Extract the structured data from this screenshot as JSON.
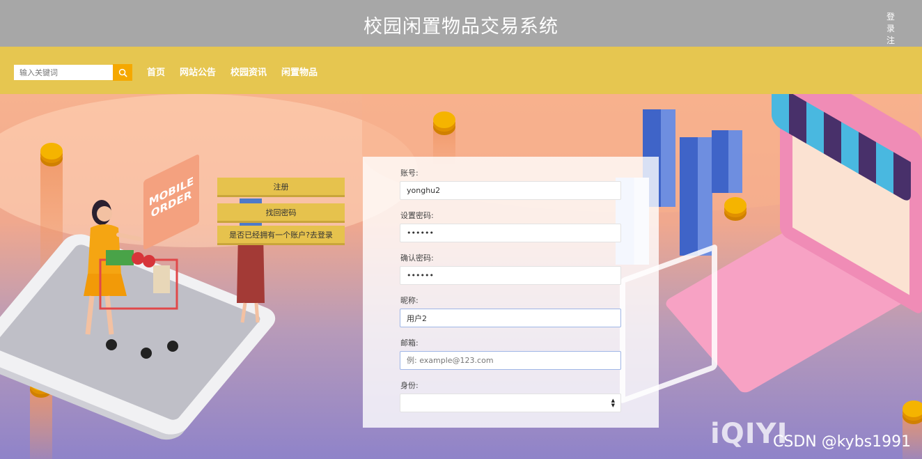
{
  "header": {
    "title": "校园闲置物品交易系统",
    "login_label": "登录",
    "register_label": "注册"
  },
  "nav": {
    "search_placeholder": "输入关键词",
    "search_icon": "search-icon",
    "links": [
      "首页",
      "网站公告",
      "校园资讯",
      "闲置物品"
    ]
  },
  "hero": {
    "sign_text": "MOBILE ORDER"
  },
  "side_buttons": {
    "register": "注册",
    "forgot_password": "找回密码",
    "have_account": "是否已经拥有一个账户?去登录"
  },
  "form": {
    "account_label": "账号:",
    "account_value": "yonghu2",
    "password_label": "设置密码:",
    "password_value": "123456",
    "confirm_label": "确认密码:",
    "confirm_value": "123456",
    "nickname_label": "昵称:",
    "nickname_value": "用户2",
    "email_label": "邮箱:",
    "email_placeholder": "例: example@123.com",
    "role_label": "身份:",
    "role_value": ""
  },
  "watermarks": {
    "iqiyi": "iQIYI",
    "csdn": "CSDN @kybs1991"
  },
  "colors": {
    "topbar": "#a7a7a7",
    "navbar": "#e6c650",
    "accent": "#f5a800",
    "button": "#e6c24d"
  }
}
